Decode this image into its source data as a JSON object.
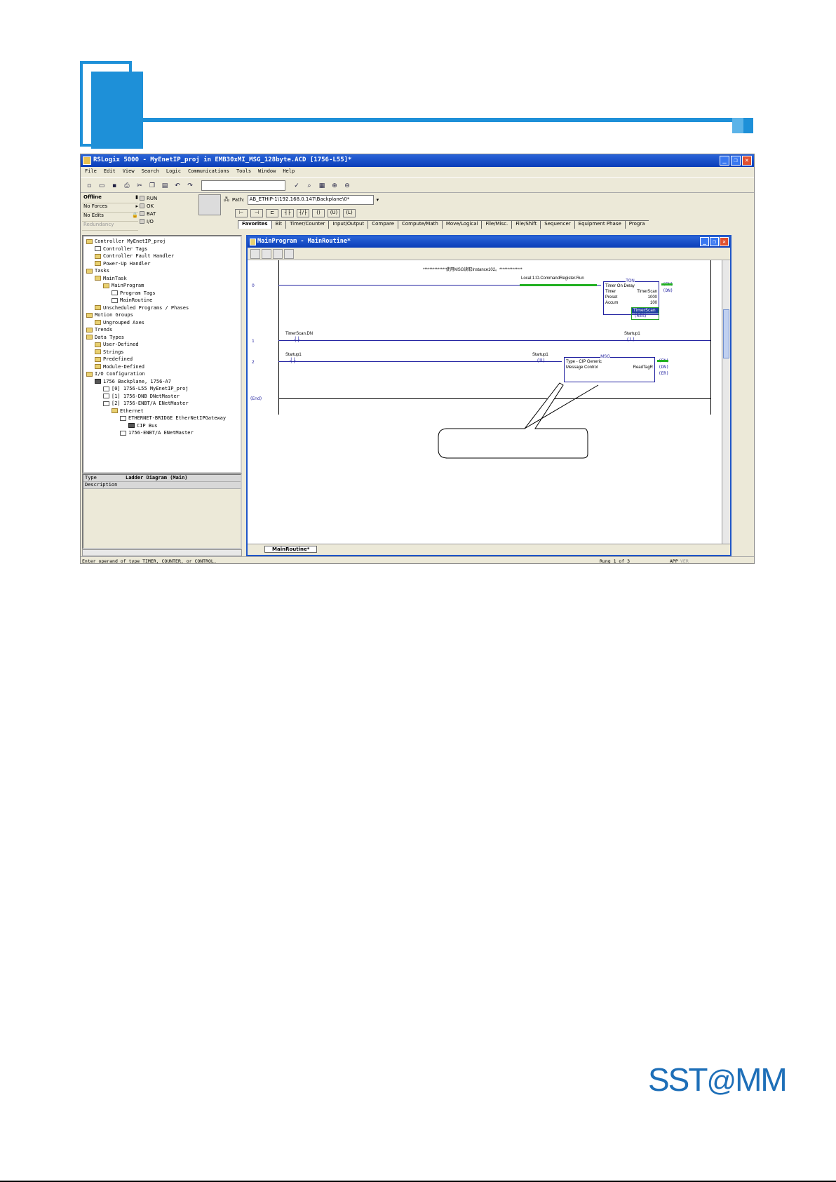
{
  "app": {
    "title": "RSLogix 5000 - MyEnetIP_proj in EMB30xMI_MSG_128byte.ACD [1756-L55]*",
    "window_buttons": [
      "_",
      "❐",
      "✕"
    ]
  },
  "menu": [
    "File",
    "Edit",
    "View",
    "Search",
    "Logic",
    "Communications",
    "Tools",
    "Window",
    "Help"
  ],
  "controller_status": {
    "mode": "Offline",
    "forces": "No Forces",
    "edits": "No Edits",
    "redundancy": "Redundancy",
    "leds": [
      "RUN",
      "OK",
      "BAT",
      "I/O"
    ]
  },
  "path": {
    "label": "Path:",
    "value": "AB_ETHIP-1\\192.168.0.147\\Backplane\\0*"
  },
  "instruction_tabs": [
    "Favorites",
    "Bit",
    "Timer/Counter",
    "Input/Output",
    "Compare",
    "Compute/Math",
    "Move/Logical",
    "File/Misc.",
    "File/Shift",
    "Sequencer",
    "Equipment Phase",
    "Progra"
  ],
  "tree": [
    {
      "indent": 0,
      "icon": "folder",
      "label": "Controller MyEnetIP_proj"
    },
    {
      "indent": 1,
      "icon": "doc",
      "label": "Controller Tags"
    },
    {
      "indent": 1,
      "icon": "folder",
      "label": "Controller Fault Handler"
    },
    {
      "indent": 1,
      "icon": "folder",
      "label": "Power-Up Handler"
    },
    {
      "indent": 0,
      "icon": "folder",
      "label": "Tasks"
    },
    {
      "indent": 1,
      "icon": "folder",
      "label": "MainTask"
    },
    {
      "indent": 2,
      "icon": "folder",
      "label": "MainProgram"
    },
    {
      "indent": 3,
      "icon": "doc",
      "label": "Program Tags"
    },
    {
      "indent": 3,
      "icon": "doc",
      "label": "MainRoutine"
    },
    {
      "indent": 1,
      "icon": "folder",
      "label": "Unscheduled Programs / Phases"
    },
    {
      "indent": 0,
      "icon": "folder",
      "label": "Motion Groups"
    },
    {
      "indent": 1,
      "icon": "folder",
      "label": "Ungrouped Axes"
    },
    {
      "indent": 0,
      "icon": "folder",
      "label": "Trends"
    },
    {
      "indent": 0,
      "icon": "folder",
      "label": "Data Types"
    },
    {
      "indent": 1,
      "icon": "folder",
      "label": "User-Defined"
    },
    {
      "indent": 1,
      "icon": "folder",
      "label": "Strings"
    },
    {
      "indent": 1,
      "icon": "folder",
      "label": "Predefined"
    },
    {
      "indent": 1,
      "icon": "folder",
      "label": "Module-Defined"
    },
    {
      "indent": 0,
      "icon": "folder",
      "label": "I/O Configuration"
    },
    {
      "indent": 1,
      "icon": "mod",
      "label": "1756 Backplane, 1756-A7"
    },
    {
      "indent": 2,
      "icon": "doc",
      "label": "[0] 1756-L55 MyEnetIP_proj"
    },
    {
      "indent": 2,
      "icon": "doc",
      "label": "[1] 1756-DNB DNetMaster"
    },
    {
      "indent": 2,
      "icon": "doc",
      "label": "[2] 1756-ENBT/A ENetMaster"
    },
    {
      "indent": 3,
      "icon": "folder",
      "label": "Ethernet"
    },
    {
      "indent": 4,
      "icon": "doc",
      "label": "ETHERNET-BRIDGE EtherNetIPGateway"
    },
    {
      "indent": 5,
      "icon": "mod",
      "label": "CIP Bus"
    },
    {
      "indent": 4,
      "icon": "doc",
      "label": "1756-ENBT/A ENetMaster"
    }
  ],
  "properties": [
    {
      "key": "Type",
      "value": "Ladder Diagram (Main)"
    },
    {
      "key": "Description",
      "value": ""
    }
  ],
  "routine": {
    "title": "MainProgram - MainRoutine*",
    "tab": "MainRoutine*"
  },
  "ladder": {
    "rung0": {
      "num": "0",
      "comment": "**************使用MSG读取Instance102。**************",
      "xic": "Local:1:O.CommandRegister.Run",
      "ton_title": "TON",
      "ton_lines": [
        "Timer On Delay",
        "Timer",
        "Preset",
        "Accum"
      ],
      "ton_values": [
        "",
        "TimerScan",
        "1000",
        "100"
      ],
      "en": "(EN)",
      "dn": "(DN)"
    },
    "rung1": {
      "num": "1",
      "contact": "TimerScan.DN",
      "coil_tag": "Startup1",
      "coil": "(L)",
      "res_tag": "TimerScan",
      "res": "(RES)"
    },
    "rung2": {
      "num": "2",
      "contact": "Startup1",
      "unlatch_tag": "Startup1",
      "unlatch": "(U)",
      "msg_title": "MSG",
      "msg_lines": [
        "Type - CIP Generic",
        "Message Control"
      ],
      "msg_tag": "ReadTagR",
      "en": "(EN)",
      "dn": "(DN)",
      "er": "(ER)"
    },
    "end": "(End)"
  },
  "status": {
    "hint": "Enter operand of type TIMER, COUNTER, or CONTROL.",
    "rung": "Rung 1 of 3",
    "app": "APP",
    "ver": "VER"
  },
  "logo": {
    "text1": "SST",
    "text2": "@",
    "text3": "MM"
  },
  "colors": {
    "accent": "#1e90d8",
    "title_blue": "#0a3db8",
    "rung_green": "#22b022"
  }
}
